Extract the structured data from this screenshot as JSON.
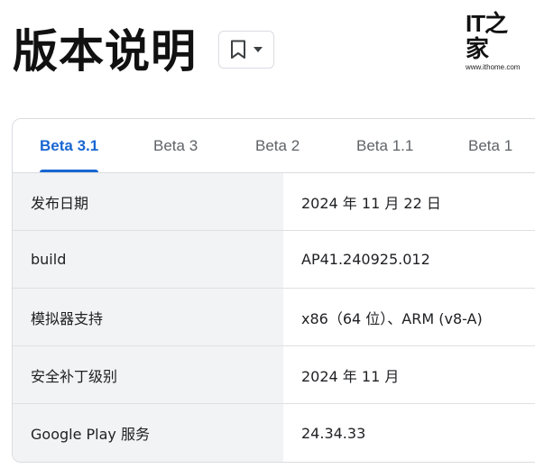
{
  "header": {
    "title": "版本说明"
  },
  "watermark": {
    "logo": "IT之家",
    "url": "www.ithome.com"
  },
  "tabs": [
    {
      "label": "Beta 3.1",
      "active": true
    },
    {
      "label": "Beta 3",
      "active": false
    },
    {
      "label": "Beta 2",
      "active": false
    },
    {
      "label": "Beta 1.1",
      "active": false
    },
    {
      "label": "Beta 1",
      "active": false
    }
  ],
  "table": {
    "rows": [
      {
        "label": "发布日期",
        "value": "2024 年 11 月 22 日"
      },
      {
        "label": "build",
        "value": "AP41.240925.012"
      },
      {
        "label": "模拟器支持",
        "value": "x86（64 位）、ARM (v8-A)"
      },
      {
        "label": "安全补丁级别",
        "value": "2024 年 11 月"
      },
      {
        "label": "Google Play 服务",
        "value": "24.34.33"
      }
    ]
  },
  "colors": {
    "accent": "#1967d2",
    "label_bg": "#f1f3f4",
    "border": "#dadce0"
  }
}
